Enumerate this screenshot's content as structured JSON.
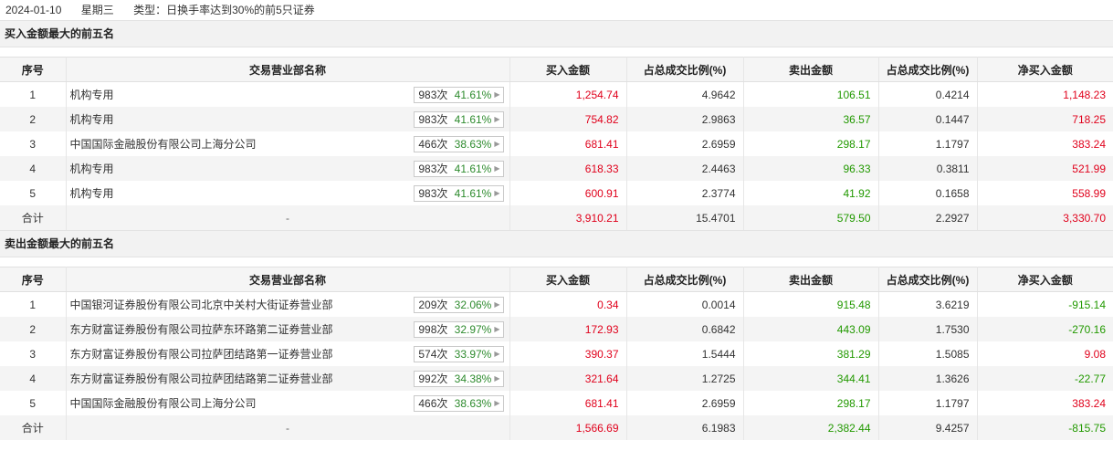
{
  "header": {
    "date": "2024-01-10",
    "weekday": "星期三",
    "type_text": "类型：日换手率达到30%的前5只证券"
  },
  "columns": [
    "序号",
    "交易营业部名称",
    "买入金额",
    "占总成交比例(%)",
    "卖出金额",
    "占总成交比例(%)",
    "净买入金额"
  ],
  "buy_section": {
    "title": "买入金额最大的前五名",
    "rows": [
      {
        "no": "1",
        "name": "机构专用",
        "count": "983次",
        "pct": "41.61%",
        "buy": "1,254.74",
        "buy_ratio": "4.9642",
        "sell": "106.51",
        "sell_ratio": "0.4214",
        "net": "1,148.23"
      },
      {
        "no": "2",
        "name": "机构专用",
        "count": "983次",
        "pct": "41.61%",
        "buy": "754.82",
        "buy_ratio": "2.9863",
        "sell": "36.57",
        "sell_ratio": "0.1447",
        "net": "718.25"
      },
      {
        "no": "3",
        "name": "中国国际金融股份有限公司上海分公司",
        "count": "466次",
        "pct": "38.63%",
        "buy": "681.41",
        "buy_ratio": "2.6959",
        "sell": "298.17",
        "sell_ratio": "1.1797",
        "net": "383.24"
      },
      {
        "no": "4",
        "name": "机构专用",
        "count": "983次",
        "pct": "41.61%",
        "buy": "618.33",
        "buy_ratio": "2.4463",
        "sell": "96.33",
        "sell_ratio": "0.3811",
        "net": "521.99"
      },
      {
        "no": "5",
        "name": "机构专用",
        "count": "983次",
        "pct": "41.61%",
        "buy": "600.91",
        "buy_ratio": "2.3774",
        "sell": "41.92",
        "sell_ratio": "0.1658",
        "net": "558.99"
      }
    ],
    "total": {
      "label": "合计",
      "name": "-",
      "buy": "3,910.21",
      "buy_ratio": "15.4701",
      "sell": "579.50",
      "sell_ratio": "2.2927",
      "net": "3,330.70"
    }
  },
  "sell_section": {
    "title": "卖出金额最大的前五名",
    "rows": [
      {
        "no": "1",
        "name": "中国银河证券股份有限公司北京中关村大街证券营业部",
        "count": "209次",
        "pct": "32.06%",
        "buy": "0.34",
        "buy_ratio": "0.0014",
        "sell": "915.48",
        "sell_ratio": "3.6219",
        "net": "-915.14"
      },
      {
        "no": "2",
        "name": "东方财富证券股份有限公司拉萨东环路第二证券营业部",
        "count": "998次",
        "pct": "32.97%",
        "buy": "172.93",
        "buy_ratio": "0.6842",
        "sell": "443.09",
        "sell_ratio": "1.7530",
        "net": "-270.16"
      },
      {
        "no": "3",
        "name": "东方财富证券股份有限公司拉萨团结路第一证券营业部",
        "count": "574次",
        "pct": "33.97%",
        "buy": "390.37",
        "buy_ratio": "1.5444",
        "sell": "381.29",
        "sell_ratio": "1.5085",
        "net": "9.08"
      },
      {
        "no": "4",
        "name": "东方财富证券股份有限公司拉萨团结路第二证券营业部",
        "count": "992次",
        "pct": "34.38%",
        "buy": "321.64",
        "buy_ratio": "1.2725",
        "sell": "344.41",
        "sell_ratio": "1.3626",
        "net": "-22.77"
      },
      {
        "no": "5",
        "name": "中国国际金融股份有限公司上海分公司",
        "count": "466次",
        "pct": "38.63%",
        "buy": "681.41",
        "buy_ratio": "2.6959",
        "sell": "298.17",
        "sell_ratio": "1.1797",
        "net": "383.24"
      }
    ],
    "total": {
      "label": "合计",
      "name": "-",
      "buy": "1,566.69",
      "buy_ratio": "6.1983",
      "sell": "2,382.44",
      "sell_ratio": "9.4257",
      "net": "-815.75"
    }
  },
  "colors": {
    "buy": "#e0001b",
    "sell": "#229900",
    "pct": "#2e8b2e",
    "header_bg": "#f2f2f2"
  }
}
